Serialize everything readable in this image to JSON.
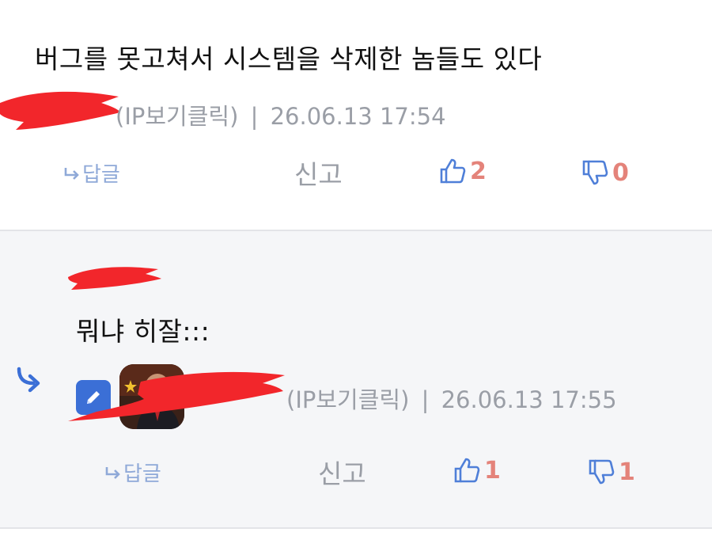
{
  "comments": [
    {
      "text": "버그를 못고쳐서 시스템을 삭제한 놈들도 있다",
      "ip_label": "(IP보기클릭)",
      "separator": "|",
      "timestamp": "26.06.13 17:54",
      "reply_label": "답글",
      "report_label": "신고",
      "upvotes": "2",
      "downvotes": "0"
    },
    {
      "text": "뭐냐 히잘:::",
      "is_reply": true
    },
    {
      "ip_label": "(IP보기클릭)",
      "separator": "|",
      "timestamp": "26.06.13 17:55",
      "reply_label": "답글",
      "report_label": "신고",
      "upvotes": "1",
      "downvotes": "1"
    }
  ],
  "colors": {
    "accent_blue": "#3b6fd6",
    "link_blue": "#8fa9d8",
    "vote_count_red": "#e4837a",
    "meta_gray": "#9a9ea6",
    "redaction_red": "#f2262b",
    "reply_background": "#f5f6f8"
  },
  "icons": {
    "reply": "reply-arrow-icon",
    "upvote": "thumbs-up-icon",
    "downvote": "thumbs-down-icon",
    "nested": "nested-reply-arrow-icon",
    "edit": "pencil-icon"
  }
}
